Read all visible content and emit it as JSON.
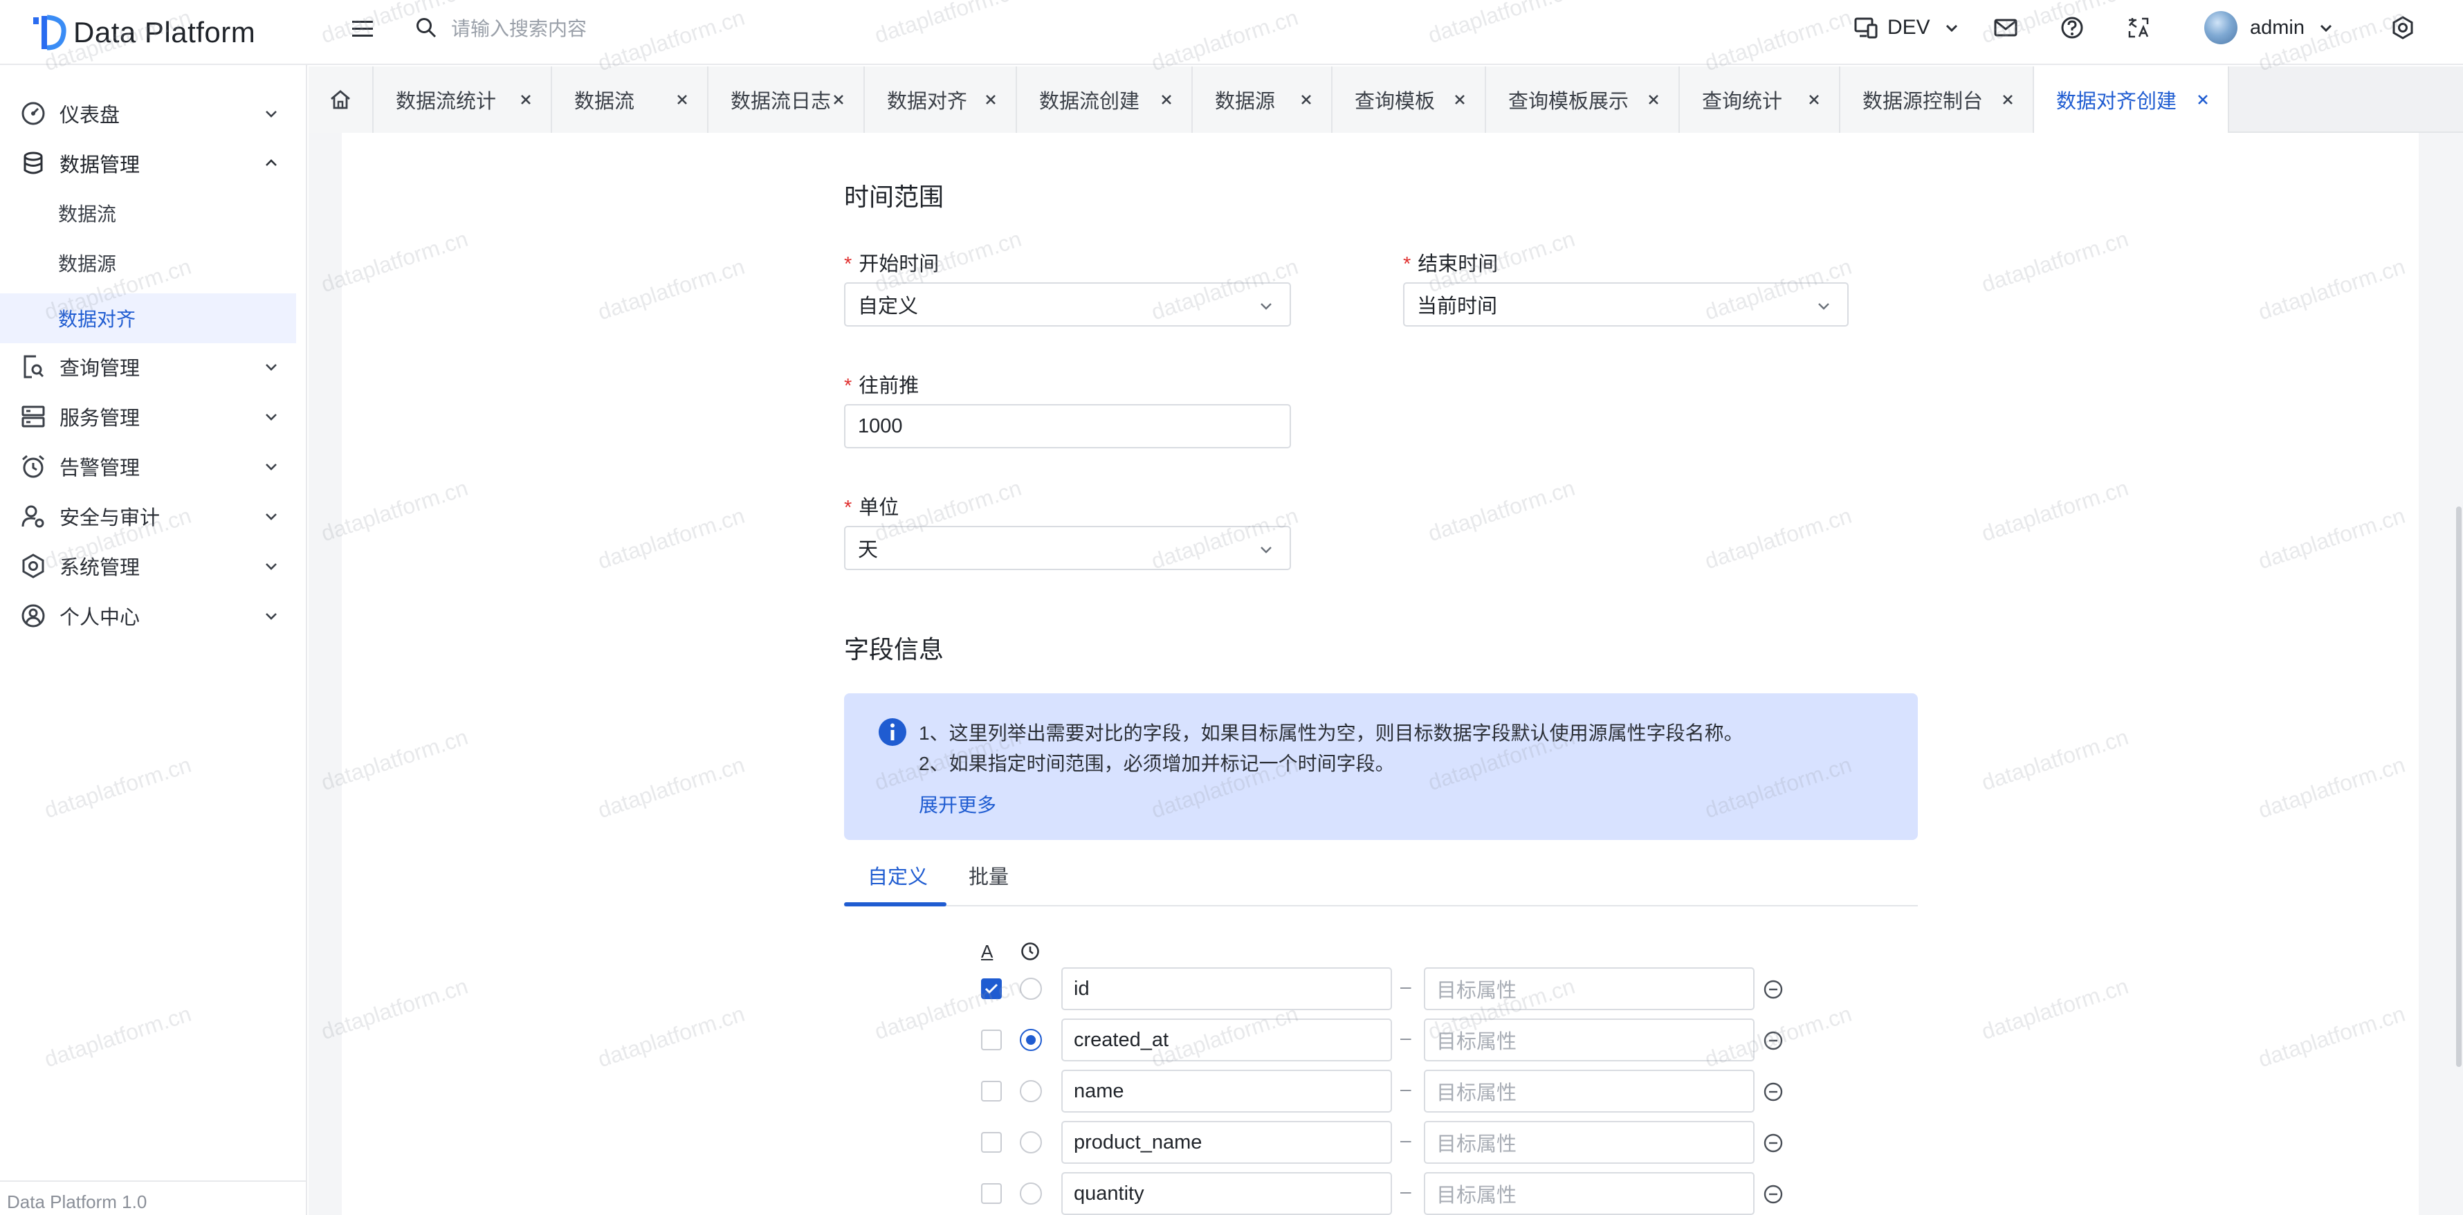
{
  "app": {
    "title": "Data Platform",
    "footer_version": "Data Platform 1.0",
    "brand_color": "#1f5cd1",
    "watermark_text": "dataplatform.cn"
  },
  "header": {
    "search_placeholder": "请输入搜索内容",
    "env_label": "DEV",
    "user_name": "admin"
  },
  "sidebar": {
    "items": [
      {
        "label": "仪表盘",
        "icon": "dashboard-icon"
      },
      {
        "label": "数据管理",
        "icon": "database-icon",
        "expanded": true
      },
      {
        "label": "查询管理",
        "icon": "query-icon"
      },
      {
        "label": "服务管理",
        "icon": "server-icon"
      },
      {
        "label": "告警管理",
        "icon": "alarm-icon"
      },
      {
        "label": "安全与审计",
        "icon": "user-shield-icon"
      },
      {
        "label": "系统管理",
        "icon": "system-icon"
      },
      {
        "label": "个人中心",
        "icon": "profile-icon"
      }
    ],
    "sub_items": [
      {
        "label": "数据流"
      },
      {
        "label": "数据源"
      },
      {
        "label": "数据对齐",
        "active": true
      }
    ]
  },
  "tabs": [
    {
      "label": "数据流统计"
    },
    {
      "label": "数据流"
    },
    {
      "label": "数据流日志"
    },
    {
      "label": "数据对齐"
    },
    {
      "label": "数据流创建"
    },
    {
      "label": "数据源"
    },
    {
      "label": "查询模板"
    },
    {
      "label": "查询模板展示"
    },
    {
      "label": "查询统计"
    },
    {
      "label": "数据源控制台"
    },
    {
      "label": "数据对齐创建",
      "active": true
    }
  ],
  "form": {
    "time_section_title": "时间范围",
    "start_time_label": "开始时间",
    "start_time_value": "自定义",
    "end_time_label": "结束时间",
    "end_time_value": "当前时间",
    "lookback_label": "往前推",
    "lookback_value": "1000",
    "unit_label": "单位",
    "unit_value": "天",
    "fields_section_title": "字段信息",
    "notice_line1": "1、这里列举出需要对比的字段，如果目标属性为空，则目标数据字段默认使用源属性字段名称。",
    "notice_line2": "2、如果指定时间范围，必须增加并标记一个时间字段。",
    "notice_more": "展开更多",
    "tab_custom": "自定义",
    "tab_batch": "批量",
    "col_a_label": "A",
    "target_placeholder": "目标属性",
    "dash": "–",
    "rows": [
      {
        "source": "id",
        "checked": true,
        "time": false
      },
      {
        "source": "created_at",
        "checked": false,
        "time": true
      },
      {
        "source": "name",
        "checked": false,
        "time": false
      },
      {
        "source": "product_name",
        "checked": false,
        "time": false
      },
      {
        "source": "quantity",
        "checked": false,
        "time": false
      }
    ]
  }
}
